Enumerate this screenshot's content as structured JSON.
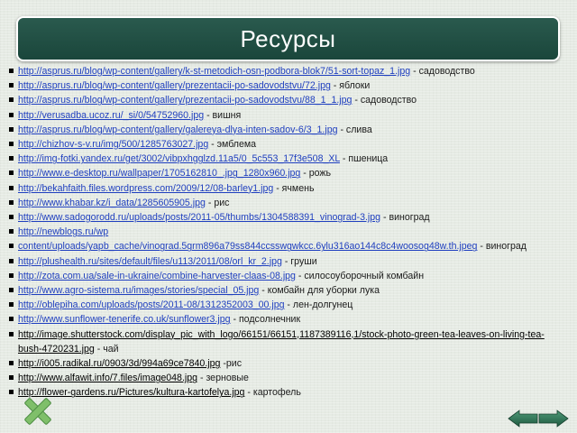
{
  "slide": {
    "title": "Ресурсы"
  },
  "resources": [
    {
      "url": "http://asprus.ru/blog/wp-content/gallery/k-st-metodich-osn-podbora-blok7/51-sort-topaz_1.jpg",
      "desc": " - садоводство"
    },
    {
      "url": "http://asprus.ru/blog/wp-content/gallery/prezentacii-po-sadovodstvu/72.jpg",
      "desc": "  - яблоки"
    },
    {
      "url": "http://asprus.ru/blog/wp-content/gallery/prezentacii-po-sadovodstvu/88_1_1.jpg",
      "desc": "  - садоводство"
    },
    {
      "url": "http://verusadba.ucoz.ru/_si/0/54752960.jpg",
      "desc": " - вишня"
    },
    {
      "url": "http://asprus.ru/blog/wp-content/gallery/galereya-dlya-inten-sadov-6/3_1.jpg",
      "desc": "  - слива"
    },
    {
      "url": "http://chizhov-s-v.ru/img/500/1285763027.jpg",
      "desc": " - эмблема"
    },
    {
      "url": "http://img-fotki.yandex.ru/get/3002/vibpxhgglzd.11a5/0_5c553_17f3e508_XL",
      "desc": "  - пшеница"
    },
    {
      "url": "http://www.e-desktop.ru/wallpaper/1705162810_.jpg_1280x960.jpg",
      "desc": "  - рожь"
    },
    {
      "url": "http://bekahfaith.files.wordpress.com/2009/12/08-barley1.jpg",
      "desc": " - ячмень"
    },
    {
      "url": "http://www.khabar.kz/i_data/1285605905.jpg",
      "desc": "  - рис"
    },
    {
      "url": "http://www.sadogorodd.ru/uploads/posts/2011-05/thumbs/1304588391_vinograd-3.jpg",
      "desc": " - виноград"
    },
    {
      "url": "http://newblogs.ru/wp",
      "desc": ""
    },
    {
      "url": "content/uploads/yapb_cache/vinograd.5grm896a79ss844ccsswgwkcc.6ylu316ao144c8c4woosog48w.th.jpeg",
      "desc": " - виноград",
      "wrap": true
    },
    {
      "url": "http://plushealth.ru/sites/default/files/u113/2011/08/orl_kr_2.jpg",
      "desc": " - груши"
    },
    {
      "url": "http://zota.com.ua/sale-in-ukraine/combine-harvester-claas-08.jpg",
      "desc": "  - силосоуборочный комбайн"
    },
    {
      "url": "http://www.agro-sistema.ru/images/stories/special_05.jpg",
      "desc": " - комбайн для уборки лука"
    },
    {
      "url": "http://oblepiha.com/uploads/posts/2011-08/1312352003_00.jpg",
      "desc": "  - лен-долгунец"
    },
    {
      "url": "http://www.sunflower-tenerife.co.uk/sunflower3.jpg",
      "desc": " - подсолнечник"
    },
    {
      "url": "http://image.shutterstock.com/display_pic_with_logo/66151/66151,1187389116,1/stock-photo-green-tea-leaves-on-living-tea-bush-4720231.jpg",
      "desc": " - чай",
      "wrap": true
    },
    {
      "url": "http://i005.radikal.ru/0903/3d/994a69ce7840.jpg",
      "desc": "  -рис"
    },
    {
      "url": "http://www.alfawit.info/7.files/image048.jpg",
      "desc": " - зерновые"
    },
    {
      "url": "http://flower-gardens.ru/Pictures/kultura-kartofelya.jpg",
      "desc": " - картофель"
    }
  ],
  "icons": {
    "close": "close-x-icon",
    "nav": "nav-arrows-icon"
  },
  "colors": {
    "title_bg": "#1f4d42",
    "link": "#1f3fbf",
    "x_green": "#7fbf6a",
    "arrow_green": "#2f7a5a"
  }
}
